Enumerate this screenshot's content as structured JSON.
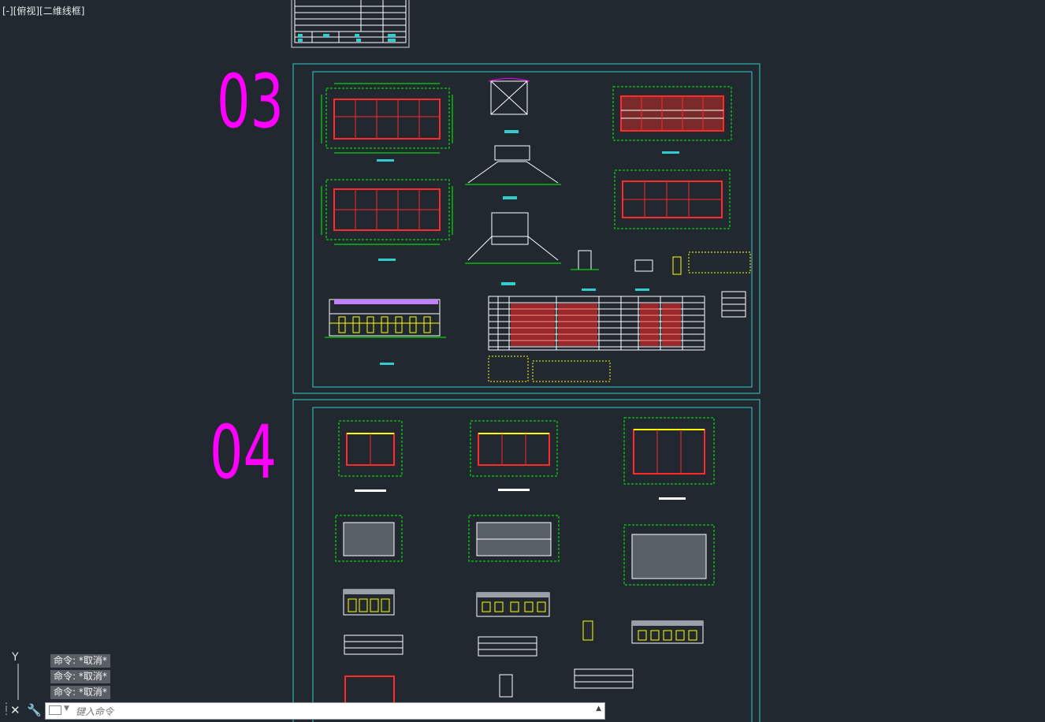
{
  "viewport": {
    "label": "[-][俯视][二维线框]"
  },
  "sheets": [
    {
      "number": "03",
      "color": "#ff00ff"
    },
    {
      "number": "04",
      "color": "#ff00ff"
    }
  ],
  "command": {
    "history": [
      "命令: *取消*",
      "命令: *取消*",
      "命令: *取消*"
    ],
    "placeholder": "键入命令"
  },
  "ucs": {
    "y_label": "Y"
  },
  "colors": {
    "background": "#212830",
    "frame": "#33cccc",
    "lines": "#00ff00",
    "red": "#ff2a2a",
    "yellow": "#ffff00",
    "magenta": "#ff00ff",
    "white": "#ffffff"
  }
}
